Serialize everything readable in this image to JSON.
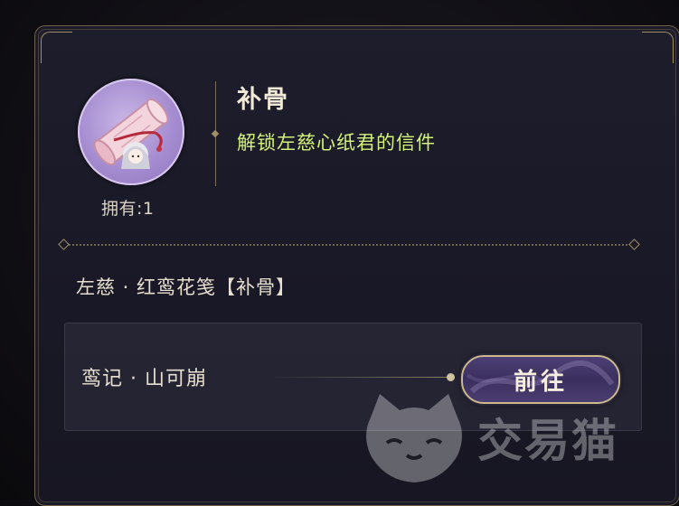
{
  "item": {
    "icon": "scroll-letter-icon",
    "owned_label": "拥有:1",
    "title": "补骨",
    "description": "解锁左慈心纸君的信件"
  },
  "source": {
    "name": "左慈 · 红鸾花笺【补骨】",
    "entries": [
      {
        "label": "鸾记 · 山可崩",
        "button_label": "前往"
      }
    ]
  },
  "watermark": {
    "text": "交易猫",
    "icon": "cat-logo-icon"
  },
  "colors": {
    "panel_bg": "#1b1a26",
    "gold_border": "#a08f63",
    "desc_green": "#d5f27a",
    "button_purple": "#3a2f5e"
  }
}
